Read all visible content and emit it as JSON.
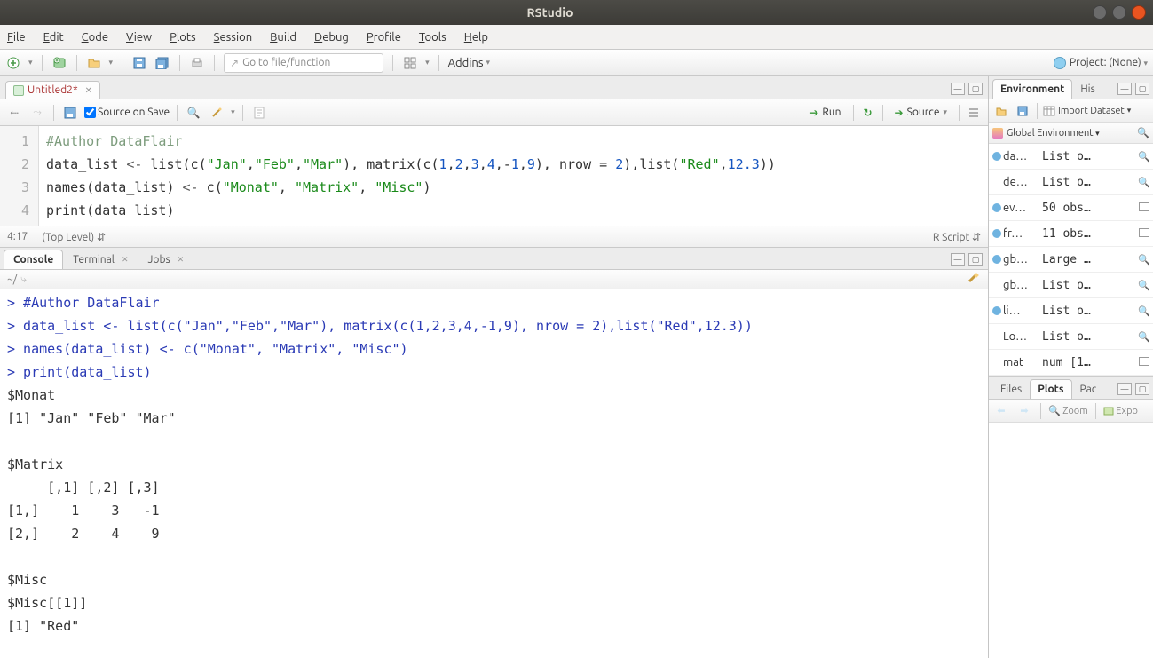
{
  "window": {
    "title": "RStudio"
  },
  "menubar": [
    "File",
    "Edit",
    "Code",
    "View",
    "Plots",
    "Session",
    "Build",
    "Debug",
    "Profile",
    "Tools",
    "Help"
  ],
  "toolbar": {
    "goto_placeholder": "Go to file/function",
    "addins_label": "Addins",
    "project_label": "Project: (None)"
  },
  "source": {
    "tab_title": "Untitled2*",
    "source_on_save": "Source on Save",
    "run_label": "Run",
    "source_label": "Source",
    "cursor_pos": "4:17",
    "scope": "(Top Level)",
    "filetype": "R Script",
    "code_lines": [
      {
        "n": 1,
        "t": "comment",
        "text": "#Author DataFlair"
      },
      {
        "n": 2,
        "t": "code",
        "text": "data_list <- list(c(\"Jan\",\"Feb\",\"Mar\"), matrix(c(1,2,3,4,-1,9), nrow = 2),list(\"Red\",12.3))"
      },
      {
        "n": 3,
        "t": "code",
        "text": "names(data_list) <- c(\"Monat\", \"Matrix\", \"Misc\")"
      },
      {
        "n": 4,
        "t": "code",
        "text": "print(data_list)"
      }
    ]
  },
  "console": {
    "tabs": [
      "Console",
      "Terminal",
      "Jobs"
    ],
    "path": "~/",
    "lines": [
      {
        "p": true,
        "text": "#Author DataFlair"
      },
      {
        "p": true,
        "text": "data_list <- list(c(\"Jan\",\"Feb\",\"Mar\"), matrix(c(1,2,3,4,-1,9), nrow = 2),list(\"Red\",12.3))"
      },
      {
        "p": true,
        "text": "names(data_list) <- c(\"Monat\", \"Matrix\", \"Misc\")"
      },
      {
        "p": true,
        "text": "print(data_list)"
      },
      {
        "p": false,
        "text": "$Monat"
      },
      {
        "p": false,
        "text": "[1] \"Jan\" \"Feb\" \"Mar\""
      },
      {
        "p": false,
        "text": ""
      },
      {
        "p": false,
        "text": "$Matrix"
      },
      {
        "p": false,
        "text": "     [,1] [,2] [,3]"
      },
      {
        "p": false,
        "text": "[1,]    1    3   -1"
      },
      {
        "p": false,
        "text": "[2,]    2    4    9"
      },
      {
        "p": false,
        "text": ""
      },
      {
        "p": false,
        "text": "$Misc"
      },
      {
        "p": false,
        "text": "$Misc[[1]]"
      },
      {
        "p": false,
        "text": "[1] \"Red\""
      }
    ]
  },
  "environment": {
    "tabs": [
      "Environment",
      "His"
    ],
    "import_label": "Import Dataset",
    "scope_label": "Global Environment",
    "rows": [
      {
        "dot": true,
        "name": "da…",
        "val": "List o…",
        "icon": "lens"
      },
      {
        "dot": false,
        "name": "de…",
        "val": "List o…",
        "icon": "lens"
      },
      {
        "dot": true,
        "name": "ev…",
        "val": "50 obs…",
        "icon": "grid"
      },
      {
        "dot": true,
        "name": "fr…",
        "val": "11 obs…",
        "icon": "grid"
      },
      {
        "dot": true,
        "name": "gb…",
        "val": "Large …",
        "icon": "lens"
      },
      {
        "dot": false,
        "name": "gb…",
        "val": "List o…",
        "icon": "lens"
      },
      {
        "dot": true,
        "name": "li…",
        "val": "List o…",
        "icon": "lens"
      },
      {
        "dot": false,
        "name": "Lo…",
        "val": "List o…",
        "icon": "lens"
      },
      {
        "dot": false,
        "name": "mat",
        "val": "num [1…",
        "icon": "grid"
      }
    ]
  },
  "plots": {
    "tabs": [
      "Files",
      "Plots",
      "Pac"
    ],
    "zoom": "Zoom",
    "export": "Expo"
  }
}
